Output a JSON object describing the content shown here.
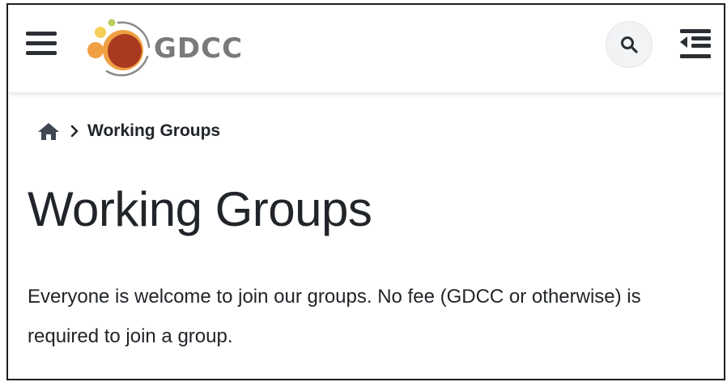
{
  "header": {
    "menu_icon": "hamburger-menu-icon",
    "logo_text": "GDCC",
    "logo_colors": {
      "dark_red": "#a93a1f",
      "orange": "#f0a042",
      "yellow": "#f5cf57",
      "green": "#b7cf5e",
      "gray": "#7a7a7a"
    },
    "search_icon": "search-icon",
    "toc_icon": "outdent-toc-icon"
  },
  "breadcrumb": {
    "home_icon": "home-icon",
    "separator_icon": "chevron-right-icon",
    "current": "Working Groups"
  },
  "main": {
    "title": "Working Groups",
    "intro": "Everyone is welcome to join our groups. No fee (GDCC or otherwise) is required to join a group."
  }
}
